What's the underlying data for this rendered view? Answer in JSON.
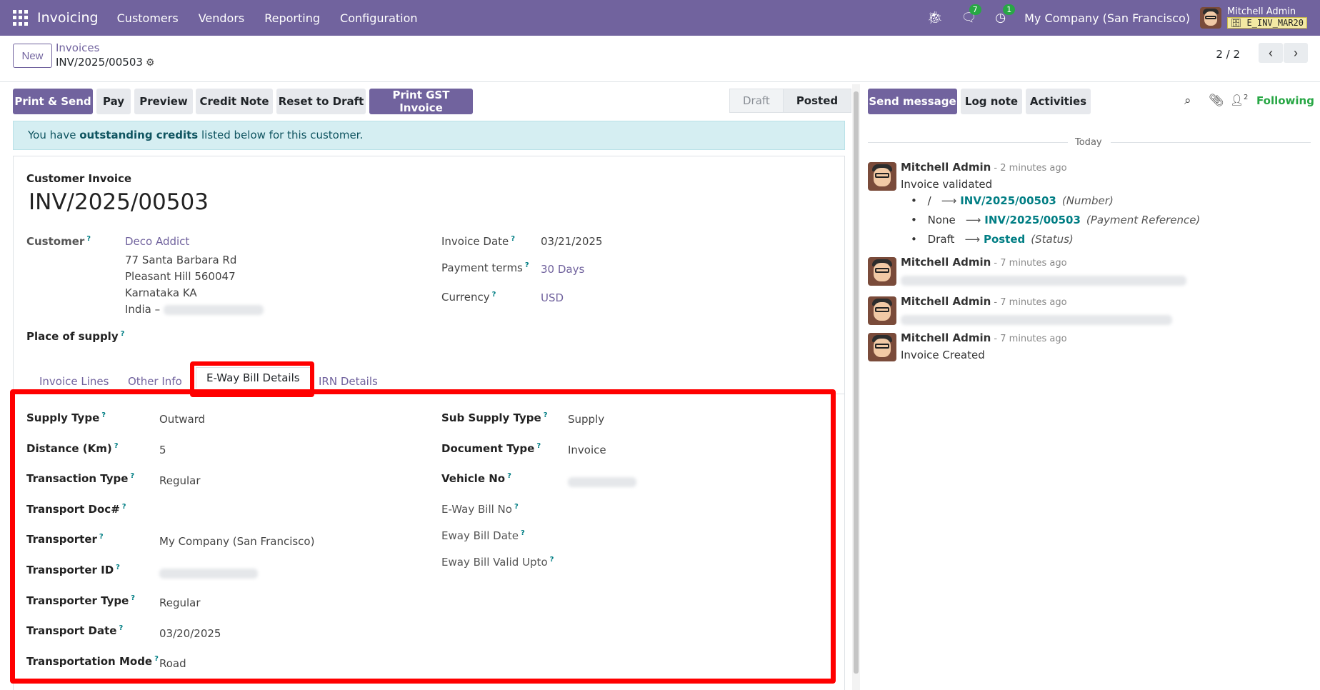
{
  "topnav": {
    "brand": "Invoicing",
    "menu": [
      "Customers",
      "Vendors",
      "Reporting",
      "Configuration"
    ],
    "messages_badge": "7",
    "activities_badge": "1",
    "company": "My Company (San Francisco)",
    "user_name": "Mitchell Admin",
    "db_name": "E_INV_MAR20"
  },
  "control": {
    "new_label": "New",
    "breadcrumb_parent": "Invoices",
    "breadcrumb_current": "INV/2025/00503",
    "pager": "2 / 2"
  },
  "actions": {
    "print_send": "Print & Send",
    "pay": "Pay",
    "preview": "Preview",
    "credit_note": "Credit Note",
    "reset_draft": "Reset to Draft",
    "print_gst": "Print GST Invoice"
  },
  "statusbar": {
    "draft": "Draft",
    "posted": "Posted"
  },
  "alert": {
    "pre": "You have ",
    "bold": "outstanding credits",
    "post": " listed below for this customer."
  },
  "invoice": {
    "type_label": "Customer Invoice",
    "number": "INV/2025/00503",
    "customer_label": "Customer",
    "customer_name": "Deco Addict",
    "address_line1": "77 Santa Barbara Rd",
    "address_line2": "Pleasant Hill 560047",
    "address_line3": "Karnataka KA",
    "address_line4": "India –",
    "place_of_supply_label": "Place of supply",
    "invoice_date_label": "Invoice Date",
    "invoice_date": "03/21/2025",
    "payment_terms_label": "Payment terms",
    "payment_terms": "30 Days",
    "currency_label": "Currency",
    "currency": "USD"
  },
  "tabs": [
    "Invoice Lines",
    "Other Info",
    "E-Way Bill Details",
    "IRN Details"
  ],
  "eway_left": [
    {
      "label": "Supply Type",
      "value": "Outward"
    },
    {
      "label": "Distance (Km)",
      "value": "5"
    },
    {
      "label": "Transaction Type",
      "value": "Regular"
    },
    {
      "label": "Transport Doc#",
      "value": ""
    },
    {
      "label": "Transporter",
      "value": "My Company (San Francisco)"
    },
    {
      "label": "Transporter ID",
      "value": ""
    },
    {
      "label": "Transporter Type",
      "value": "Regular"
    },
    {
      "label": "Transport Date",
      "value": "03/20/2025"
    },
    {
      "label": "Transportation Mode",
      "value": "Road"
    }
  ],
  "eway_right": [
    {
      "label": "Sub Supply Type",
      "value": "Supply"
    },
    {
      "label": "Document Type",
      "value": "Invoice"
    },
    {
      "label": "Vehicle No",
      "value": ""
    },
    {
      "label": "E-Way Bill No",
      "value": ""
    },
    {
      "label": "Eway Bill Date",
      "value": ""
    },
    {
      "label": "Eway Bill Valid Upto",
      "value": ""
    }
  ],
  "chatter": {
    "send_message": "Send message",
    "log_note": "Log note",
    "activities": "Activities",
    "followers_count": "2",
    "following": "Following",
    "today": "Today",
    "messages": [
      {
        "author": "Mitchell Admin",
        "time": " - 2 minutes ago",
        "body": "Invoice validated"
      },
      {
        "author": "Mitchell Admin",
        "time": " - 7 minutes ago",
        "body": ""
      },
      {
        "author": "Mitchell Admin",
        "time": " - 7 minutes ago",
        "body": ""
      },
      {
        "author": "Mitchell Admin",
        "time": " - 7 minutes ago",
        "body": "Invoice Created"
      }
    ],
    "tracking": [
      {
        "old": "/",
        "new": "INV/2025/00503",
        "field": "(Number)"
      },
      {
        "old": "None",
        "new": "INV/2025/00503",
        "field": "(Payment Reference)"
      },
      {
        "old": "Draft",
        "new": "Posted",
        "field": "(Status)"
      }
    ]
  }
}
